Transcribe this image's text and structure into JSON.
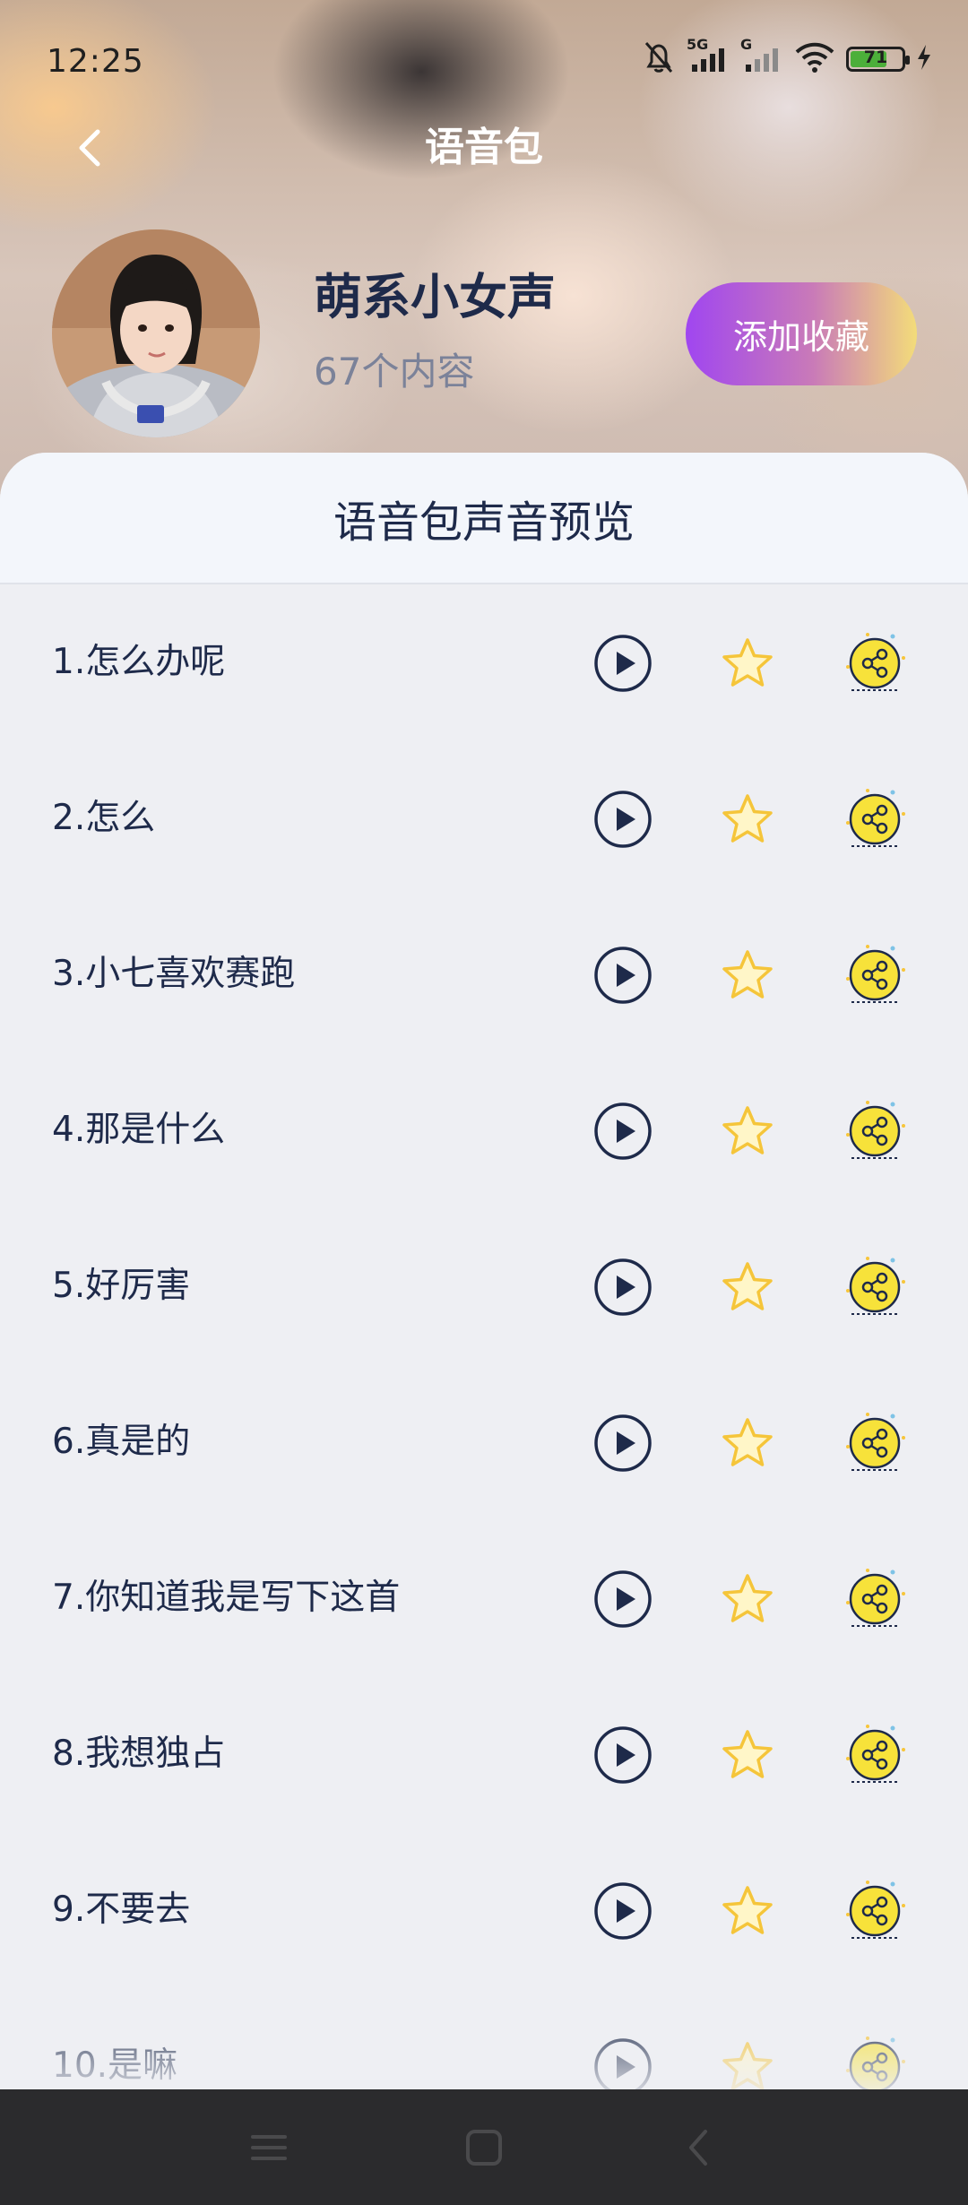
{
  "status_bar": {
    "time": "12:25",
    "network_label": "5G",
    "network2_label": "G",
    "battery_level": "71",
    "battery_fraction": 0.71
  },
  "header": {
    "title": "语音包",
    "back_icon": "chevron-left-icon"
  },
  "pack": {
    "name": "萌系小女声",
    "count": "67个内容",
    "favorite_label": "添加收藏"
  },
  "preview": {
    "title": "语音包声音预览",
    "items": [
      {
        "label": "1.怎么办呢"
      },
      {
        "label": "2.怎么"
      },
      {
        "label": "3.小七喜欢赛跑"
      },
      {
        "label": "4.那是什么"
      },
      {
        "label": "5.好厉害"
      },
      {
        "label": "6.真是的"
      },
      {
        "label": "7.你知道我是写下这首"
      },
      {
        "label": "8.我想独占"
      },
      {
        "label": "9.不要去"
      },
      {
        "label": "10.是嘛"
      }
    ]
  },
  "colors": {
    "accent_start": "#a046f0",
    "accent_end": "#f3dc7a",
    "text_primary": "#1e2a4a",
    "star": "#f5c53a",
    "share_badge": "#f7e23a"
  }
}
